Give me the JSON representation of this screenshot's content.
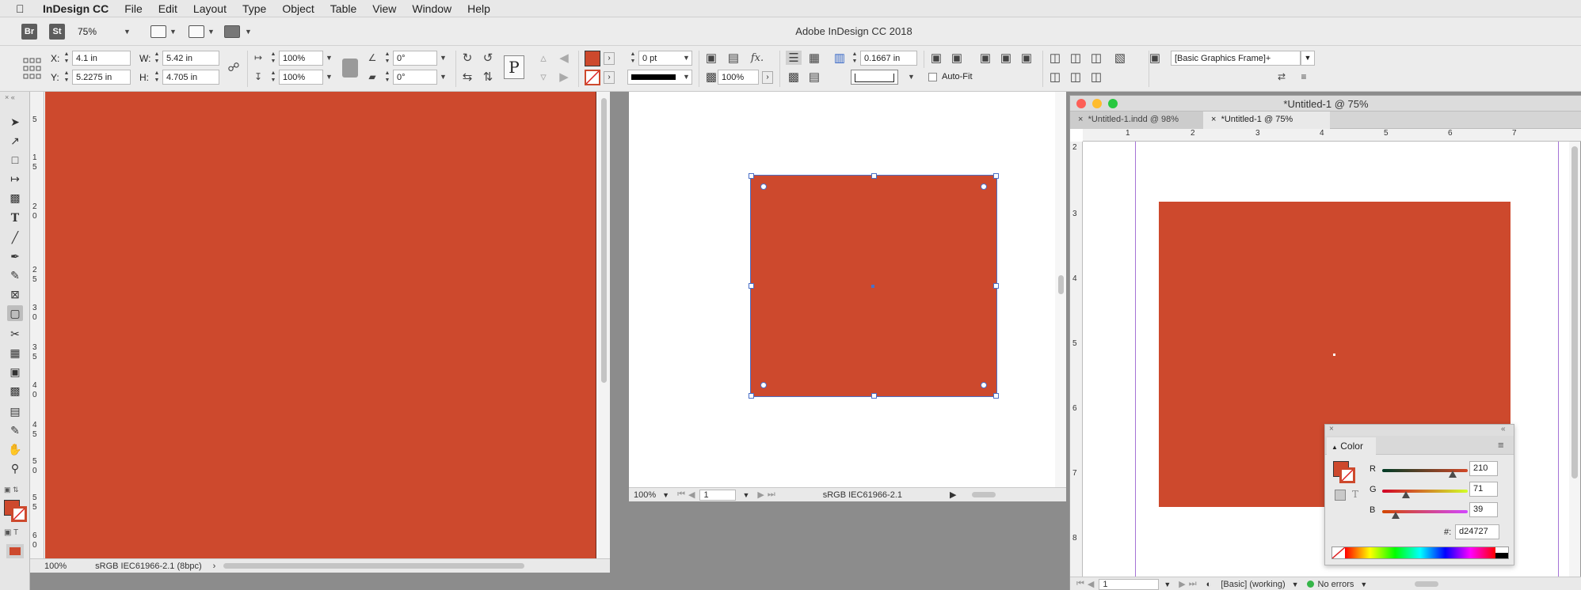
{
  "menubar": {
    "app_name": "InDesign CC",
    "items": [
      "File",
      "Edit",
      "Layout",
      "Type",
      "Object",
      "Table",
      "View",
      "Window",
      "Help"
    ]
  },
  "appbar": {
    "bridge": "Br",
    "stock": "St",
    "zoom": "75%",
    "title": "Adobe InDesign CC 2018"
  },
  "control": {
    "x_label": "X:",
    "x_value": "4.1 in",
    "y_label": "Y:",
    "y_value": "5.2275 in",
    "w_label": "W:",
    "w_value": "5.42 in",
    "h_label": "H:",
    "h_value": "4.705 in",
    "scale_x": "100%",
    "scale_y": "100%",
    "rotate": "0°",
    "shear": "0°",
    "stroke_weight": "0 pt",
    "opacity": "100%",
    "gap": "0.1667 in",
    "autofit_label": "Auto-Fit",
    "style": "[Basic Graphics Frame]+",
    "fill_color": "#cd492d"
  },
  "left_window": {
    "zoom": "100%",
    "profile": "sRGB IEC61966-2.1 (8bpc)",
    "ruler_labels": [
      "5",
      "1",
      "5",
      "2",
      "0",
      "2",
      "5",
      "3",
      "0",
      "3",
      "5",
      "4",
      "0",
      "4",
      "5",
      "5",
      "0",
      "5",
      "5",
      "6",
      "0"
    ]
  },
  "middle_window": {
    "zoom": "100%",
    "page": "1",
    "profile": "sRGB IEC61966-2.1"
  },
  "right_window": {
    "title": "*Untitled-1 @ 75%",
    "tabs": [
      "*Untitled-1.indd @ 98%",
      "*Untitled-1 @ 75%"
    ],
    "ruler_h": [
      "1",
      "2",
      "3",
      "4",
      "5",
      "6",
      "7"
    ],
    "ruler_v": [
      "2",
      "3",
      "4",
      "5",
      "6",
      "7",
      "8"
    ],
    "page": "1",
    "style": "[Basic] (working)",
    "errors": "No errors"
  },
  "color_panel": {
    "title": "Color",
    "r_label": "R",
    "g_label": "G",
    "b_label": "B",
    "r": "210",
    "g": "71",
    "b": "39",
    "hex_label": "#:",
    "hex": "d24727",
    "r_level": 0.824,
    "g_level": 0.278,
    "b_level": 0.153
  }
}
